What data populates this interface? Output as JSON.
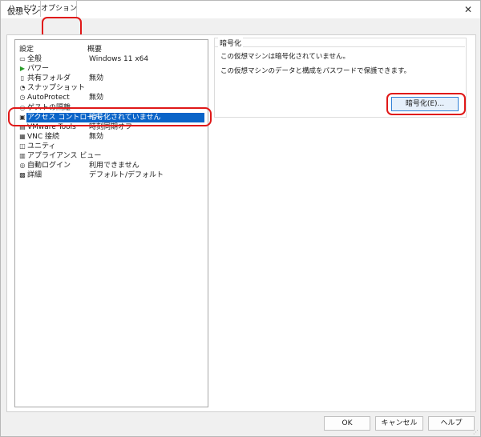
{
  "window": {
    "title": "仮想マシン設定",
    "close_glyph": "✕"
  },
  "tabs": {
    "hardware": "ハードウェア",
    "options": "オプション"
  },
  "list": {
    "header_setting": "設定",
    "header_summary": "概要",
    "rows": [
      {
        "icon": "general-icon",
        "glyph": "▭",
        "name": "全般",
        "value": "Windows 11 x64"
      },
      {
        "icon": "power-icon",
        "glyph": "▶",
        "name": "パワー",
        "value": ""
      },
      {
        "icon": "shared-folder-icon",
        "glyph": "▯",
        "name": "共有フォルダ",
        "value": "無効"
      },
      {
        "icon": "snapshot-icon",
        "glyph": "◔",
        "name": "スナップショット",
        "value": ""
      },
      {
        "icon": "autoprotect-icon",
        "glyph": "◷",
        "name": "AutoProtect",
        "value": "無効"
      },
      {
        "icon": "guest-isolation-icon",
        "glyph": "○",
        "name": "ゲストの隔離",
        "value": ""
      },
      {
        "icon": "access-control-icon",
        "glyph": "▣",
        "name": "アクセス コントロール",
        "value": "暗号化されていません"
      },
      {
        "icon": "vmware-tools-icon",
        "glyph": "▤",
        "name": "VMware Tools",
        "value": "時刻同期オフ"
      },
      {
        "icon": "vnc-icon",
        "glyph": "▦",
        "name": "VNC 接続",
        "value": "無効"
      },
      {
        "icon": "unity-icon",
        "glyph": "◫",
        "name": "ユニティ",
        "value": ""
      },
      {
        "icon": "appliance-view-icon",
        "glyph": "▥",
        "name": "アプライアンス ビュー",
        "value": ""
      },
      {
        "icon": "autologin-icon",
        "glyph": "◎",
        "name": "自動ログイン",
        "value": "利用できません"
      },
      {
        "icon": "advanced-icon",
        "glyph": "▩",
        "name": "詳細",
        "value": "デフォルト/デフォルト"
      }
    ]
  },
  "encryption": {
    "title": "暗号化",
    "status": "この仮想マシンは暗号化されていません。",
    "description": "この仮想マシンのデータと構成をパスワードで保護できます。",
    "button": "暗号化(E)..."
  },
  "footer": {
    "ok": "OK",
    "cancel": "キャンセル",
    "help": "ヘルプ"
  },
  "colors": {
    "selection": "#0a64c8",
    "highlight": "#e01818",
    "button_focus": "#2f7fd6"
  }
}
